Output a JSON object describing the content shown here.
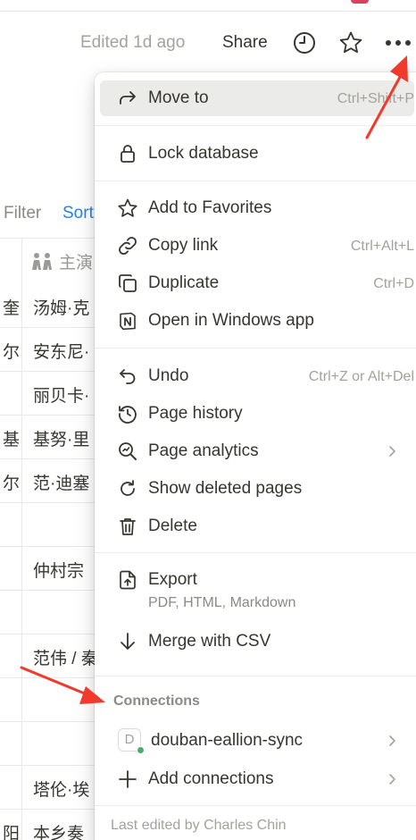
{
  "topbar": {
    "edited": "Edited 1d ago",
    "share": "Share",
    "icons": [
      "history-clock-icon",
      "favorite-star-icon",
      "more-horizontal-icon"
    ]
  },
  "view_toolbar": {
    "filter": "Filter",
    "sort": "Sort"
  },
  "table": {
    "header": "主演",
    "rows": [
      {
        "col1": "奎",
        "col2": "汤姆·克"
      },
      {
        "col1": "尔",
        "col2": "安东尼·"
      },
      {
        "col1": "",
        "col2": "丽贝卡·"
      },
      {
        "col1": "基",
        "col2": "基努·里"
      },
      {
        "col1": "尔",
        "col2": "范·迪塞"
      },
      {
        "col1": "",
        "col2": ""
      },
      {
        "col1": "",
        "col2": "仲村宗"
      },
      {
        "col1": "",
        "col2": ""
      },
      {
        "col1": "",
        "col2": "范伟 / 秦"
      },
      {
        "col1": "",
        "col2": ""
      },
      {
        "col1": "",
        "col2": ""
      },
      {
        "col1": "",
        "col2": "塔伦·埃"
      },
      {
        "col1": "阳",
        "col2": "本乡奏"
      }
    ]
  },
  "menu": {
    "move_to": {
      "label": "Move to",
      "shortcut": "Ctrl+Shift+P"
    },
    "lock_database": {
      "label": "Lock database"
    },
    "add_to_favorites": {
      "label": "Add to Favorites"
    },
    "copy_link": {
      "label": "Copy link",
      "shortcut": "Ctrl+Alt+L"
    },
    "duplicate": {
      "label": "Duplicate",
      "shortcut": "Ctrl+D"
    },
    "open_in_windows_app": {
      "label": "Open in Windows app"
    },
    "undo": {
      "label": "Undo",
      "shortcut": "Ctrl+Z or Alt+Del"
    },
    "page_history": {
      "label": "Page history"
    },
    "page_analytics": {
      "label": "Page analytics"
    },
    "show_deleted_pages": {
      "label": "Show deleted pages"
    },
    "delete": {
      "label": "Delete"
    },
    "export": {
      "label": "Export",
      "sublabel": "PDF, HTML, Markdown"
    },
    "merge_with_csv": {
      "label": "Merge with CSV"
    },
    "connections_heading": "Connections",
    "connection": {
      "avatar_letter": "D",
      "label": "douban-eallion-sync",
      "status_color": "#4dab6f"
    },
    "add_connections": {
      "label": "Add connections"
    },
    "footer": "Last edited by Charles Chin"
  },
  "colors": {
    "annotation_arrow": "#f03a2c",
    "sort_link": "#2383e2",
    "hover_bg": "#ebebea"
  }
}
